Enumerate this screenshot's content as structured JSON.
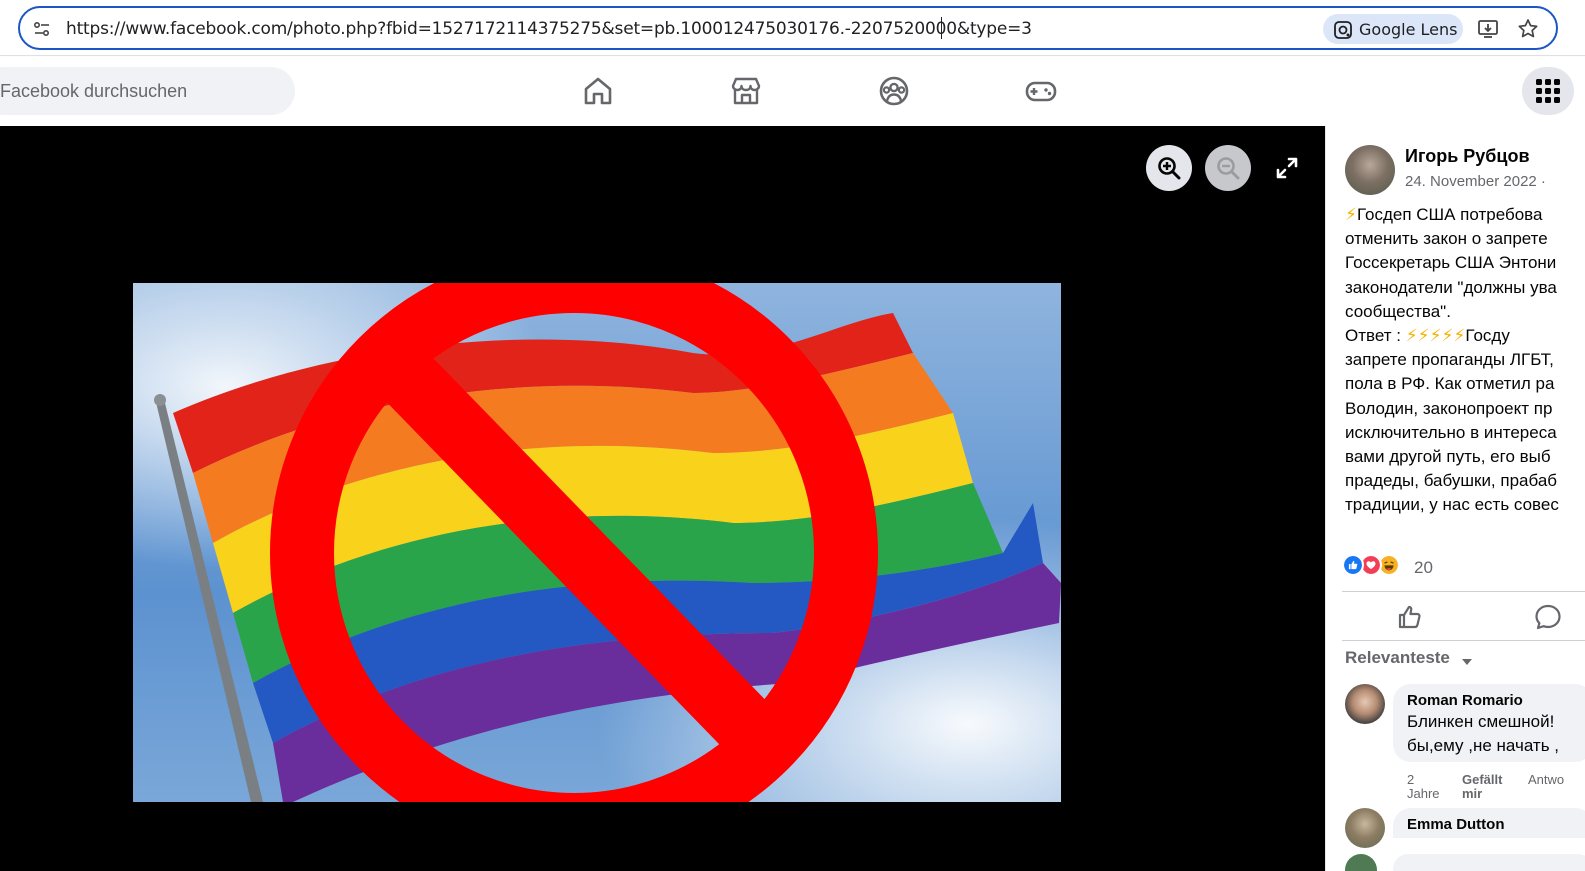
{
  "browser": {
    "url": "https://www.facebook.com/photo.php?fbid=1527172114375275&set=pb.100012475030176.-2207520000&type=3",
    "lens_label": "Google Lens",
    "icons": [
      "tune-icon",
      "google-lens-icon",
      "install-app-icon",
      "bookmark-star-icon"
    ]
  },
  "fb_header": {
    "search_placeholder": "Facebook durchsuchen",
    "nav": [
      "home-icon",
      "marketplace-icon",
      "groups-icon",
      "gaming-icon"
    ],
    "menu_icon": "apps-grid-icon"
  },
  "viewer": {
    "controls": [
      "zoom-in-icon",
      "zoom-out-icon",
      "fullscreen-icon"
    ],
    "photo_subject": "rainbow-flag-with-prohibition-sign"
  },
  "post": {
    "author": "Игорь Рубцов",
    "date": "24. November 2022 ·",
    "lines": [
      "Госдеп США потребова",
      "отменить закон о запрете",
      "Госсекретарь США Энтони",
      "законодатели \"должны ува",
      "сообщества\".",
      "Ответ :",
      "запрете пропаганды ЛГБТ,",
      "пола в РФ. Как отметил ра",
      "Володин, законопроект пр",
      "исключительно в интереса",
      "вами другой путь, его выб",
      "прадеды, бабушки, прабаб",
      "традиции, у нас есть совес"
    ],
    "line6_tail": "Госду",
    "reaction_count": "20",
    "colors": {
      "like": "#1877f2",
      "love": "#f33e58",
      "haha": "#f7b125"
    }
  },
  "comments": {
    "sort_label": "Relevanteste",
    "items": [
      {
        "name": "Roman Romario",
        "line1": "Блинкен смешной!",
        "line2": "бы,ему ,не начать ,",
        "time_a": "2",
        "time_b": "Jahre",
        "like_a": "Gefällt",
        "like_b": "mir",
        "reply": "Antwo"
      },
      {
        "name": "Emma Dutton"
      }
    ]
  }
}
